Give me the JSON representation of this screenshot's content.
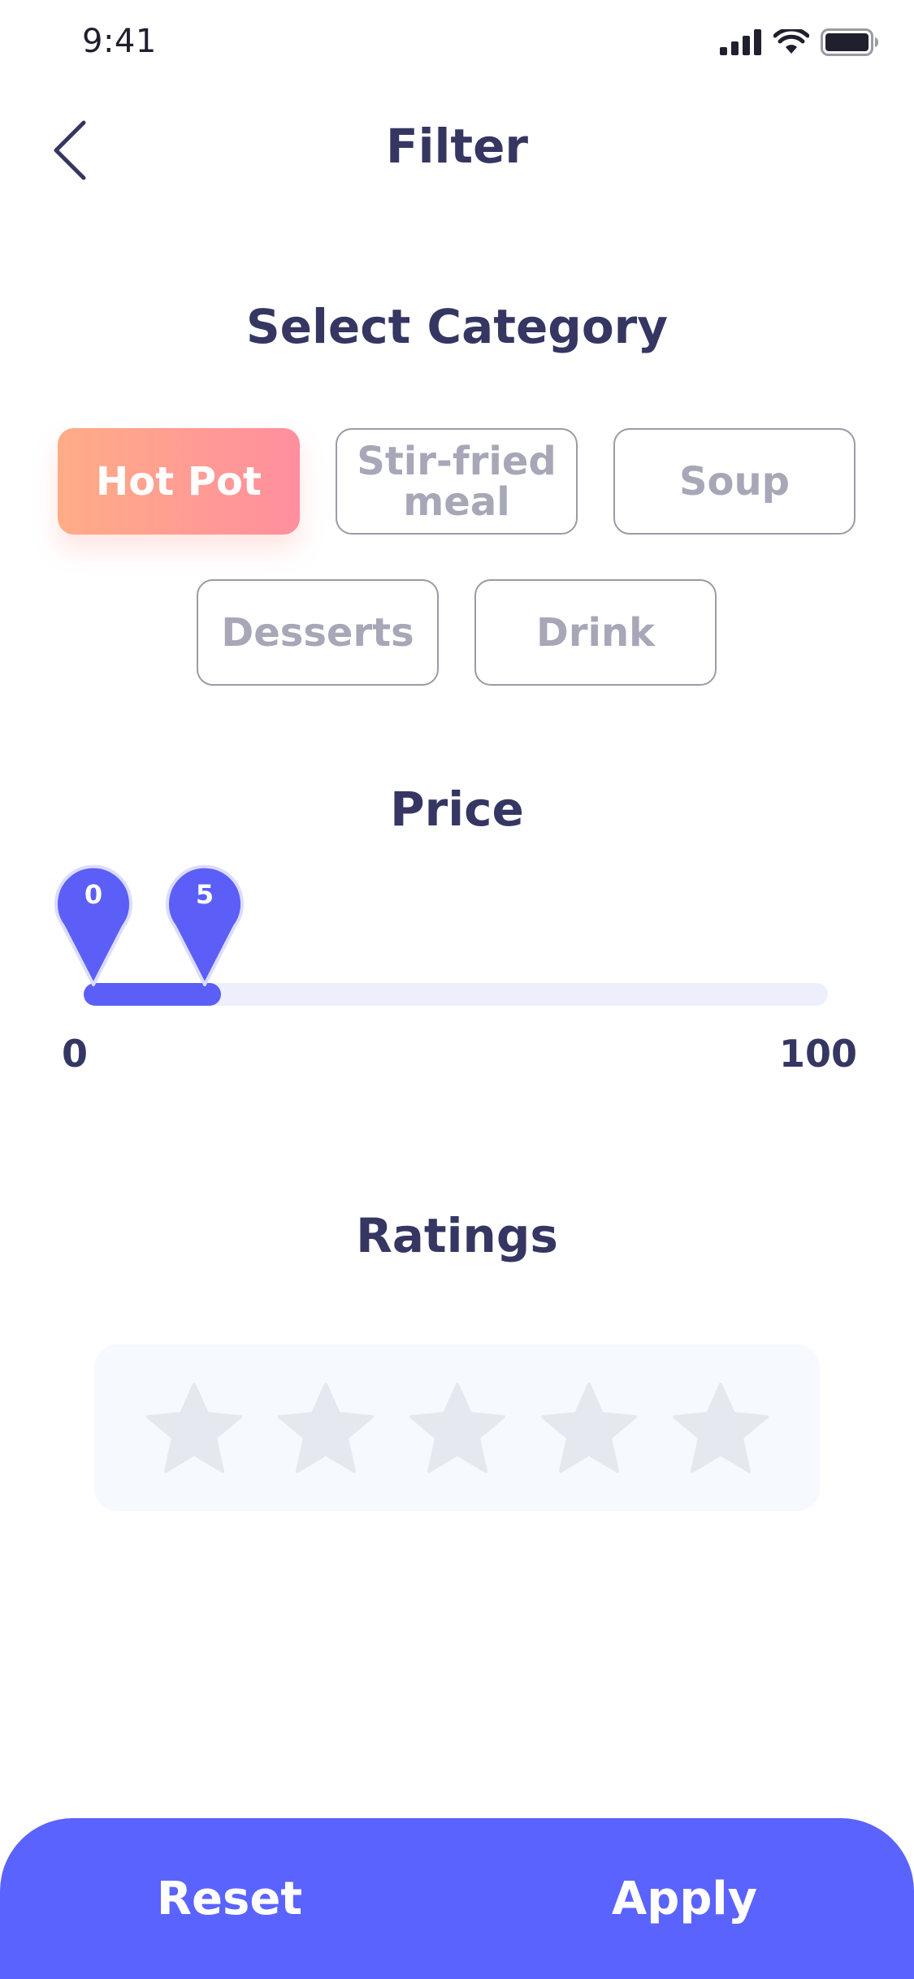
{
  "status_bar": {
    "time": "9:41",
    "icons": [
      "signal-icon",
      "wifi-icon",
      "battery-icon"
    ]
  },
  "header": {
    "title": "Filter",
    "back_icon": "chevron-left-icon"
  },
  "category": {
    "title": "Select Category",
    "chips": [
      {
        "label": "Hot Pot",
        "selected": true
      },
      {
        "label": "Stir-fried meal",
        "selected": false
      },
      {
        "label": "Soup",
        "selected": false
      },
      {
        "label": "Desserts",
        "selected": false
      },
      {
        "label": "Drink",
        "selected": false
      }
    ]
  },
  "price": {
    "title": "Price",
    "min_label": "0",
    "max_label": "100",
    "selected_min": "0",
    "selected_max": "5"
  },
  "ratings": {
    "title": "Ratings",
    "stars": 5,
    "selected": 0
  },
  "footer": {
    "reset_label": "Reset",
    "apply_label": "Apply"
  },
  "colors": {
    "primary": "#5b63fe",
    "slider_fill": "#5b5ff7",
    "chip_gradient_start": "#ffac86",
    "chip_gradient_end": "#ff8e9e",
    "title_text": "#363663",
    "muted_text": "#a7a7b7",
    "star_inactive": "#e6e8ef"
  }
}
